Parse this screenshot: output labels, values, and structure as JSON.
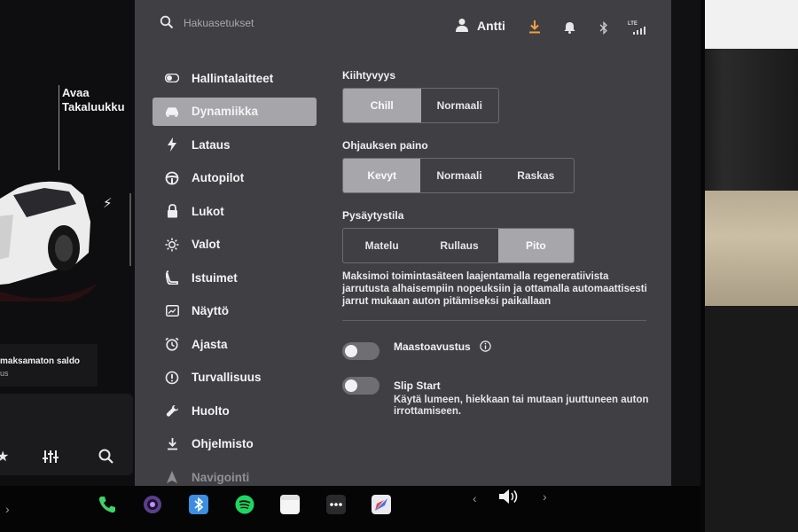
{
  "search": {
    "placeholder": "Hakuasetukset"
  },
  "status_bar": {
    "user_name": "Antti",
    "network": "LTE"
  },
  "car_panel": {
    "trunk_label": "Avaa Takaluukku",
    "balance_text": "maksamaton saldo",
    "balance_sub": "us"
  },
  "nav": {
    "items": [
      {
        "label": "Hallintalaitteet",
        "icon": "toggle-icon"
      },
      {
        "label": "Dynamiikka",
        "icon": "car-icon",
        "active": true
      },
      {
        "label": "Lataus",
        "icon": "bolt-icon"
      },
      {
        "label": "Autopilot",
        "icon": "steering-wheel-icon"
      },
      {
        "label": "Lukot",
        "icon": "lock-icon"
      },
      {
        "label": "Valot",
        "icon": "sun-icon"
      },
      {
        "label": "Istuimet",
        "icon": "seat-icon"
      },
      {
        "label": "Näyttö",
        "icon": "display-icon"
      },
      {
        "label": "Ajasta",
        "icon": "alarm-clock-icon"
      },
      {
        "label": "Turvallisuus",
        "icon": "info-circle-icon"
      },
      {
        "label": "Huolto",
        "icon": "wrench-icon"
      },
      {
        "label": "Ohjelmisto",
        "icon": "download-icon"
      },
      {
        "label": "Navigointi",
        "icon": "navigation-icon"
      }
    ]
  },
  "acceleration": {
    "title": "Kiihtyvyys",
    "options": [
      "Chill",
      "Normaali"
    ],
    "selected": "Chill"
  },
  "steering": {
    "title": "Ohjauksen paino",
    "options": [
      "Kevyt",
      "Normaali",
      "Raskas"
    ],
    "selected": "Kevyt"
  },
  "stopping": {
    "title": "Pysäytystila",
    "options": [
      "Matelu",
      "Rullaus",
      "Pito"
    ],
    "selected": "Pito",
    "description": "Maksimoi toimintasäteen laajentamalla regeneratiivista jarrutusta alhaisempiin nopeuksiin ja ottamalla automaattisesti jarrut mukaan auton pitämiseksi paikallaan"
  },
  "offroad": {
    "title": "Maastoavustus",
    "enabled": false
  },
  "slip_start": {
    "title": "Slip Start",
    "description": "Käytä lumeen, hiekkaan tai mutaan juuttuneen auton irrottamiseen.",
    "enabled": false
  },
  "colors": {
    "panel_bg": "#3f3f44",
    "selected_bg": "#a7a7ab",
    "download_accent": "#f0a13a"
  }
}
